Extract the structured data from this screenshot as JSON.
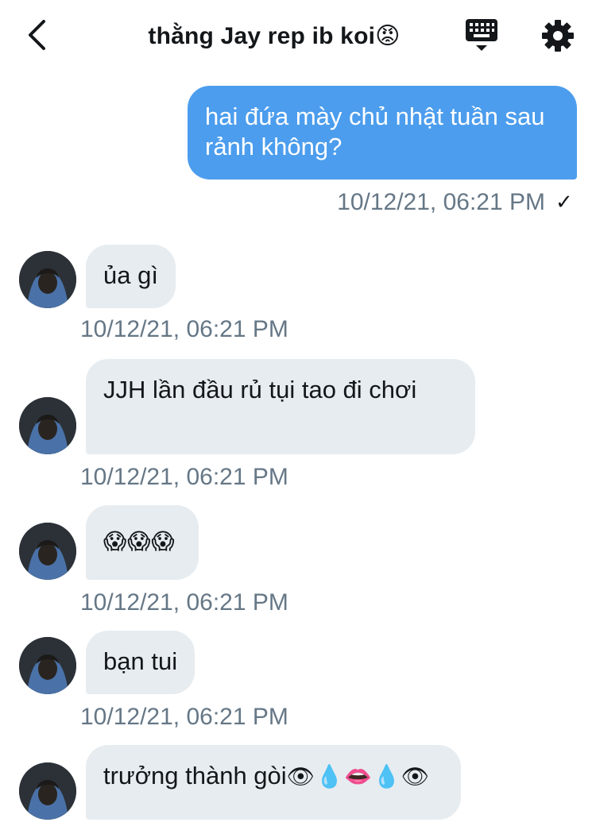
{
  "header": {
    "title": "thằng Jay rep ib koi",
    "title_emoji": "😡"
  },
  "colors": {
    "outgoing_bubble": "#4c9ded",
    "incoming_bubble": "#e6ecf0",
    "timestamp": "#657786"
  },
  "icons": {
    "back": "chevron-left-icon",
    "keyboard": "keyboard-icon",
    "settings": "gear-icon"
  },
  "messages": {
    "outgoing": {
      "text": "hai đứa mày chủ nhật tuần sau rảnh không?",
      "timestamp": "10/12/21, 06:21 PM",
      "status": "✓"
    },
    "incoming": [
      {
        "text": "ủa gì",
        "timestamp": "10/12/21, 06:21 PM"
      },
      {
        "text": "JJH lần đầu rủ tụi tao đi chơi",
        "timestamp": "10/12/21, 06:21 PM"
      },
      {
        "text": "😱😱😱",
        "timestamp": "10/12/21, 06:21 PM"
      },
      {
        "text": "bạn tui",
        "timestamp": "10/12/21, 06:21 PM"
      },
      {
        "text": "trưởng thành gòi",
        "emoji": "👁💧👄💧👁"
      }
    ]
  }
}
